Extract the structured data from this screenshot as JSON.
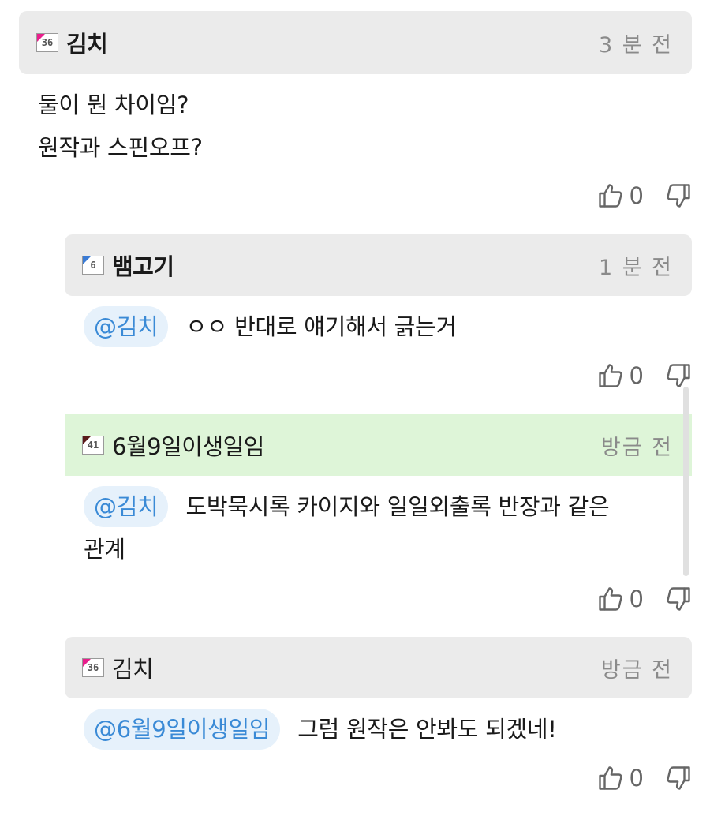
{
  "comments": [
    {
      "level": "36",
      "author": "김치",
      "time": "3 분 전",
      "lines": [
        "둘이 뭔 차이임?",
        "원작과 스핀오프?"
      ],
      "likes": "0",
      "badge_color": "#e91e8c"
    },
    {
      "level": "6",
      "author": "뱀고기",
      "time": "1 분 전",
      "mention": "@김치",
      "text": "ㅇㅇ 반대로 얘기해서 긁는거",
      "likes": "0",
      "badge_color": "#3a7bd5"
    },
    {
      "level": "41",
      "author": "6월9일이생일임",
      "time": "방금 전",
      "mention": "@김치",
      "text": "도박묵시록 카이지와 일일외출록 반장과 같은",
      "text_cont": "관계",
      "likes": "0",
      "badge_color": "#5a1a1a"
    },
    {
      "level": "36",
      "author": "김치",
      "time": "방금 전",
      "mention": "@6월9일이생일임",
      "text": "그럼 원작은 안봐도 되겠네!",
      "likes": "0",
      "badge_color": "#e91e8c"
    }
  ],
  "icons": {
    "like": "thumbs-up-icon",
    "dislike": "thumbs-down-icon"
  }
}
